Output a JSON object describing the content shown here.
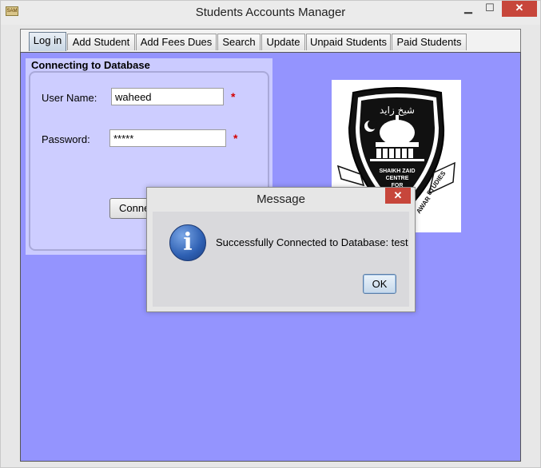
{
  "window": {
    "title": "Students Accounts Manager",
    "app_icon_text": "SAM",
    "minimize_glyph": "▁",
    "maximize_glyph": "☐",
    "close_glyph": "✕"
  },
  "tabs": [
    {
      "label": "Log in",
      "active": true
    },
    {
      "label": "Add Student",
      "active": false
    },
    {
      "label": "Add Fees Dues",
      "active": false
    },
    {
      "label": "Search",
      "active": false
    },
    {
      "label": "Update",
      "active": false
    },
    {
      "label": "Unpaid Students",
      "active": false
    },
    {
      "label": "Paid Students",
      "active": false
    }
  ],
  "login_panel": {
    "title": "Connecting to Database",
    "username_label": "User Name:",
    "username_value": "waheed",
    "password_label": "Password:",
    "password_value": "*****",
    "required_marker": "*",
    "connect_button": "Connect"
  },
  "logo": {
    "arabic_text": "شیخ زاید",
    "lines": [
      "SHAIKH ZAID",
      "CENTRE",
      "FOR"
    ],
    "ribbon_text": "STUDIES",
    "ribbon_text_2": "AWAR"
  },
  "dialog": {
    "title": "Message",
    "close_glyph": "✕",
    "icon_glyph": "i",
    "message": "Successfully Connected to Database: test",
    "ok_button": "OK"
  },
  "colors": {
    "content_background": "#9494fe",
    "panel_background": "#cbcbff",
    "close_red": "#c7463b",
    "required_red": "#d40000"
  }
}
